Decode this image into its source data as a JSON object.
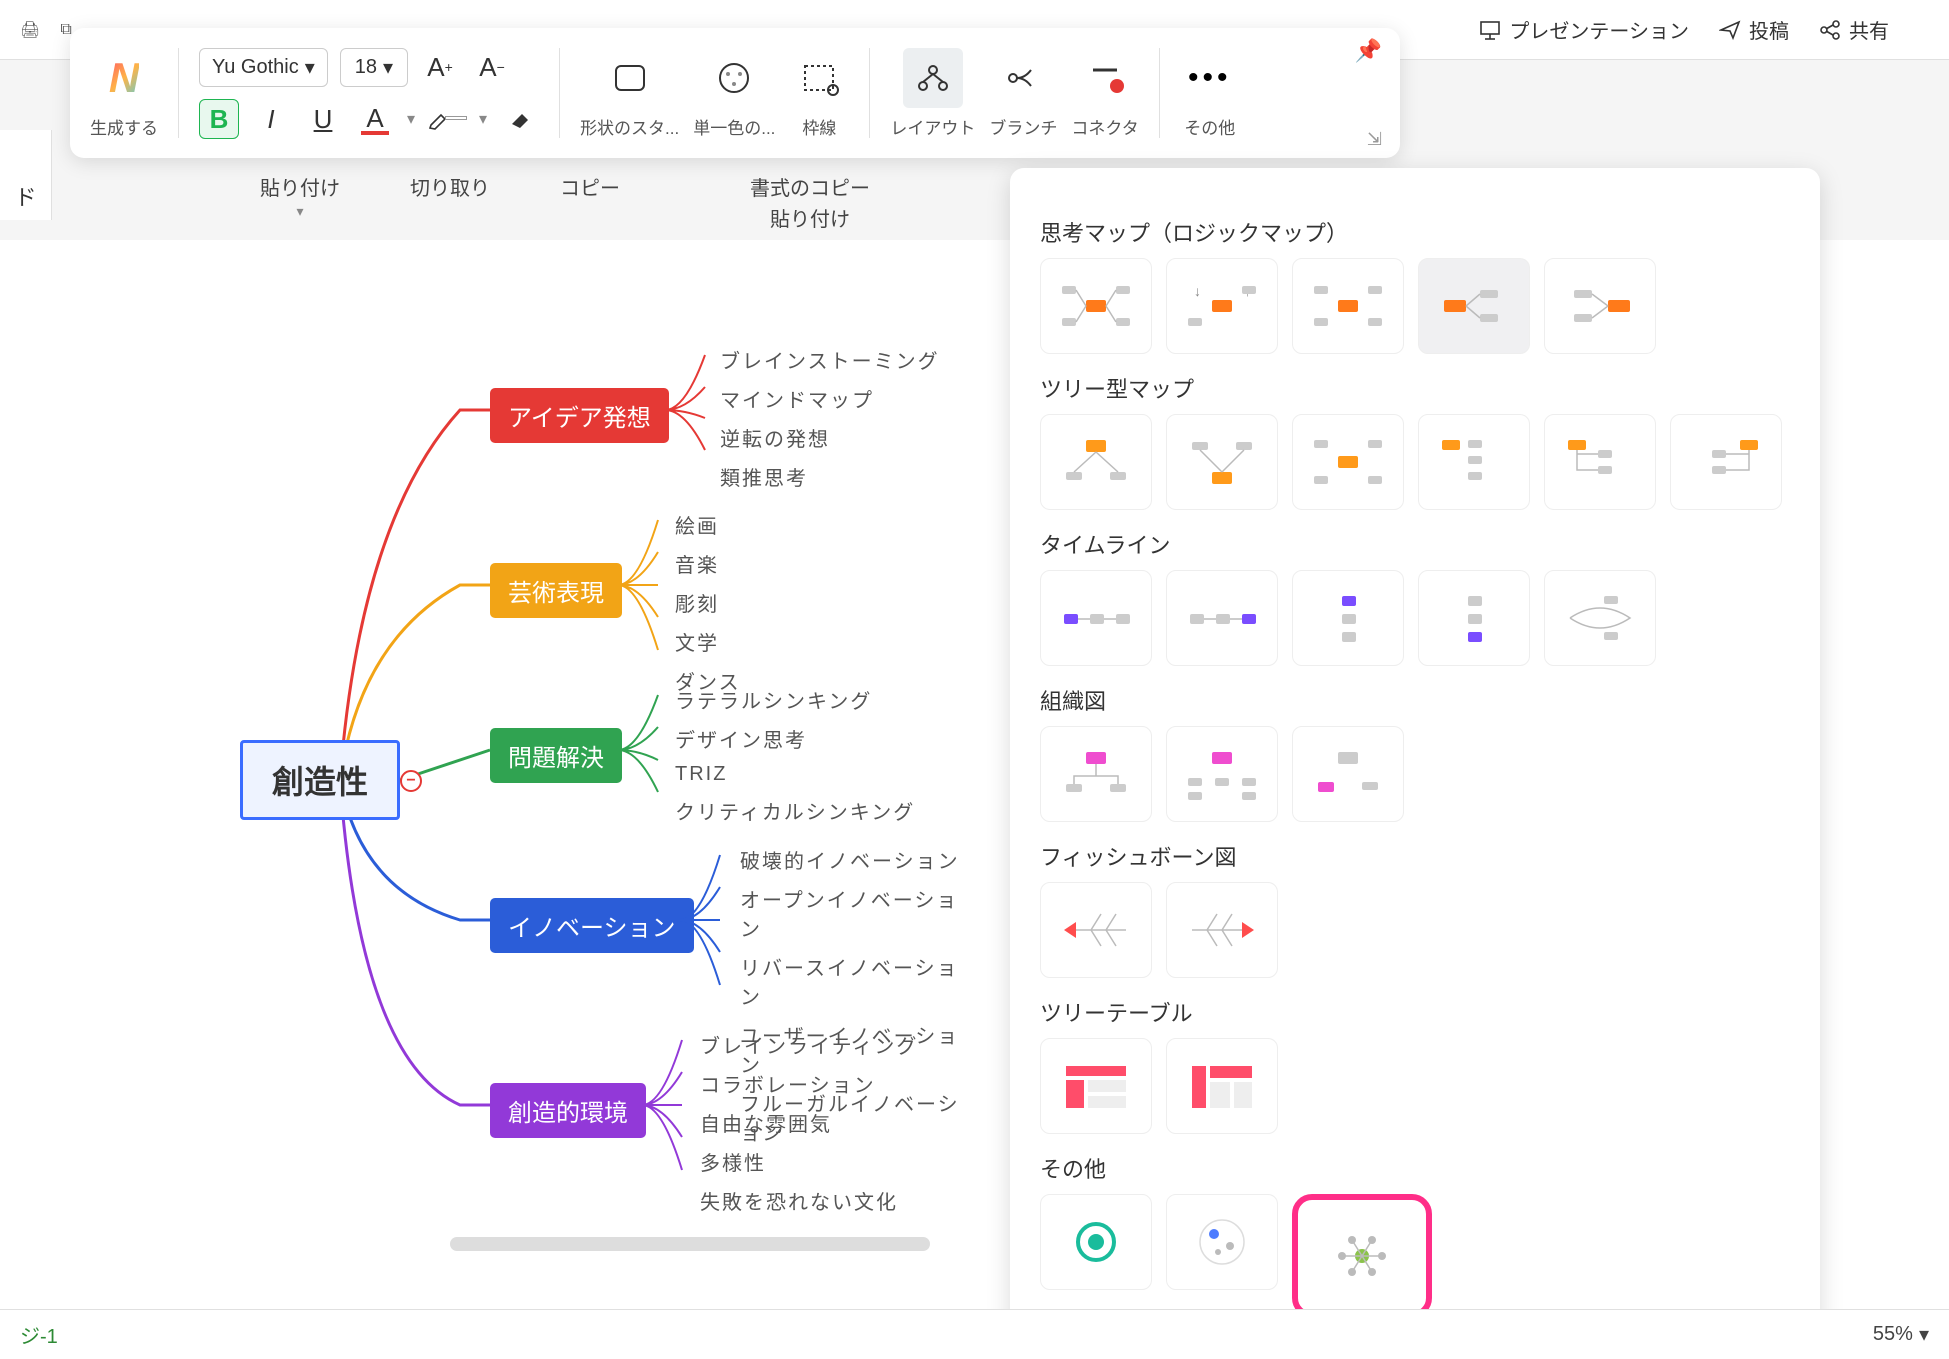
{
  "header": {
    "presentation": "プレゼンテーション",
    "post": "投稿",
    "share": "共有"
  },
  "toolbar": {
    "generate": "生成する",
    "font_name": "Yu Gothic",
    "font_size": "18",
    "bold": "B",
    "italic": "I",
    "underline": "U",
    "font_color_label": "A",
    "shape_style": "形状のスタ...",
    "single_color": "単一色の...",
    "border": "枠線",
    "layout": "レイアウト",
    "branch": "ブランチ",
    "connector": "コネクタ",
    "more": "その他"
  },
  "secondary": {
    "paste": "貼り付け",
    "cut": "切り取り",
    "copy": "コピー",
    "format_copy": "書式のコピー",
    "format_paste": "貼り付け"
  },
  "left_strip": "ド",
  "mindmap": {
    "root": "創造性",
    "branches": [
      {
        "label": "アイデア発想",
        "color": "red",
        "leaves": [
          "ブレインストーミング",
          "マインドマップ",
          "逆転の発想",
          "類推思考"
        ]
      },
      {
        "label": "芸術表現",
        "color": "orange",
        "leaves": [
          "絵画",
          "音楽",
          "彫刻",
          "文学",
          "ダンス"
        ]
      },
      {
        "label": "問題解決",
        "color": "green",
        "leaves": [
          "ラテラルシンキング",
          "デザイン思考",
          "TRIZ",
          "クリティカルシンキング"
        ]
      },
      {
        "label": "イノベーション",
        "color": "blue",
        "leaves": [
          "破壊的イノベーション",
          "オープンイノベーション",
          "リバースイノベーション",
          "ユーザーイノベーション",
          "フルーガルイノベーション"
        ]
      },
      {
        "label": "創造的環境",
        "color": "purple",
        "leaves": [
          "ブレインライティング",
          "コラボレーション",
          "自由な雰囲気",
          "多様性",
          "失敗を恐れない文化"
        ]
      }
    ]
  },
  "layout_panel": {
    "sections": {
      "mindmap": "思考マップ（ロジックマップ）",
      "tree": "ツリー型マップ",
      "timeline": "タイムライン",
      "org": "組織図",
      "fishbone": "フィッシュボーン図",
      "treetable": "ツリーテーブル",
      "other": "その他"
    }
  },
  "footer": {
    "page": "ジ-1",
    "zoom": "55%"
  }
}
